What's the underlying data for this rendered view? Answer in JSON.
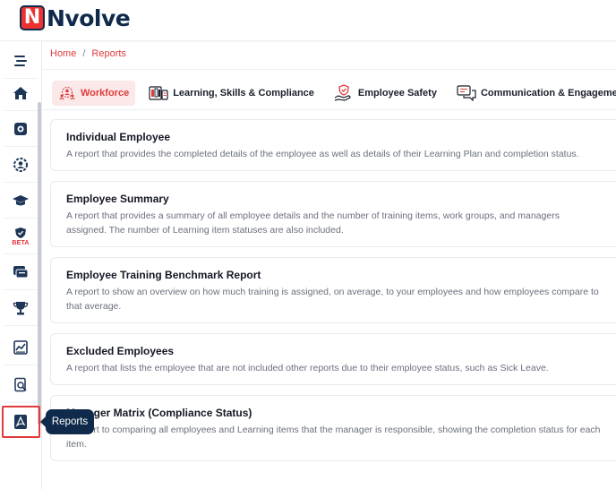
{
  "app": {
    "brand": "Nvolve",
    "brand_mark": "N"
  },
  "breadcrumb": {
    "items": [
      "Home",
      "Reports"
    ],
    "separator": "/"
  },
  "sidebar": {
    "items": [
      {
        "icon": "hamburger-menu-icon"
      },
      {
        "icon": "home-icon"
      },
      {
        "icon": "gear-badge-icon"
      },
      {
        "icon": "settings-user-icon"
      },
      {
        "icon": "graduation-cap-icon"
      },
      {
        "icon": "shield-beta-icon",
        "badge": "BETA"
      },
      {
        "icon": "chat-icon"
      },
      {
        "icon": "trophy-icon"
      },
      {
        "icon": "chart-icon"
      },
      {
        "icon": "document-search-icon"
      },
      {
        "icon": "pdf-report-icon",
        "active": true
      }
    ],
    "tooltip": "Reports"
  },
  "tabs": [
    {
      "label": "Workforce",
      "icon": "people-icon",
      "active": true
    },
    {
      "label": "Learning, Skills & Compliance",
      "icon": "books-icon"
    },
    {
      "label": "Employee Safety",
      "icon": "hand-shield-icon"
    },
    {
      "label": "Communication & Engagement",
      "icon": "chat-bubbles-icon"
    }
  ],
  "reports": [
    {
      "title": "Individual Employee",
      "description": "A report that provides the completed details of the employee as well as details of their Learning Plan and completion status."
    },
    {
      "title": "Employee Summary",
      "description": "A report that provides a summary of all employee details and the number of training items, work groups, and managers assigned. The number of Learning item statuses are also included."
    },
    {
      "title": "Employee Training Benchmark Report",
      "description": "A report to show an overview on how much training is assigned, on average, to your employees and how employees compare to that average."
    },
    {
      "title": "Excluded Employees",
      "description": "A report that lists the employee that are not included other reports due to their employee status, such as Sick Leave."
    },
    {
      "title": "Manager Matrix (Compliance Status)",
      "description": "A report to comparing all employees and Learning items that the manager is responsible, showing the completion status for each item."
    }
  ],
  "colors": {
    "accent": "#e03b3b",
    "navy": "#0f2a4a",
    "tab_active_bg": "#fbe8e8"
  }
}
